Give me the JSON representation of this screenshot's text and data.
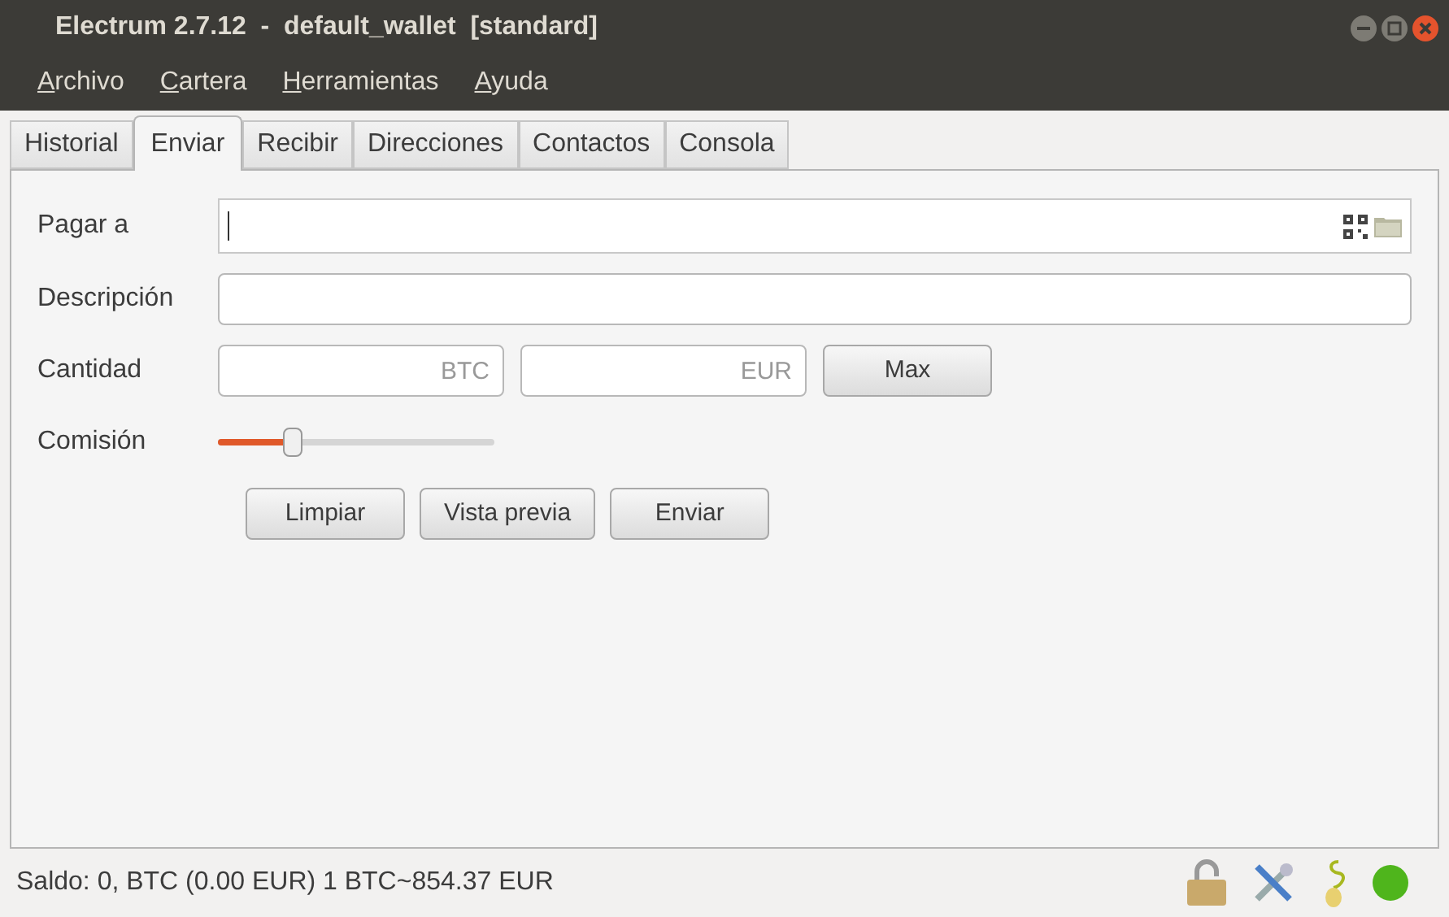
{
  "window": {
    "title": "Electrum 2.7.12  -  default_wallet  [standard]"
  },
  "menu": [
    "Archivo",
    "Cartera",
    "Herramientas",
    "Ayuda"
  ],
  "tabs": [
    {
      "label": "Historial",
      "selected": false
    },
    {
      "label": "Enviar",
      "selected": true
    },
    {
      "label": "Recibir",
      "selected": false
    },
    {
      "label": "Direcciones",
      "selected": false
    },
    {
      "label": "Contactos",
      "selected": false
    },
    {
      "label": "Consola",
      "selected": false
    }
  ],
  "form": {
    "pay_to_label": "Pagar a",
    "description_label": "Descripción",
    "amount_label": "Cantidad",
    "btc_placeholder": "BTC",
    "eur_placeholder": "EUR",
    "max_button": "Max",
    "fee_label": "Comisión",
    "fee": {
      "level": 0.27
    }
  },
  "buttons": [
    "Limpiar",
    "Vista previa",
    "Enviar"
  ],
  "status_bar": {
    "balance": "Saldo: 0, BTC (0.00 EUR) 1 BTC~854.37 EUR"
  }
}
